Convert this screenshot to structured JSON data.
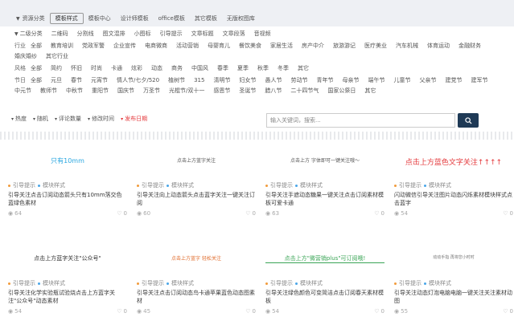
{
  "topbar": {
    "items": [
      "资源分类",
      "模板样式",
      "模板中心",
      "设计师模板",
      "office模板",
      "其它模板",
      "无版权图库"
    ]
  },
  "filters": {
    "category": {
      "label": "",
      "items": [
        "二级分类",
        "二维码",
        "分割线",
        "图文混排",
        "小图标",
        "引导提示",
        "文章标题",
        "文章段落",
        "音视频"
      ]
    },
    "industry": {
      "label": "行业",
      "items": [
        "全部",
        "教育培训",
        "党政军警",
        "企业宣传",
        "电商微商",
        "活动营销",
        "母婴育儿",
        "餐饮美食",
        "家居生活",
        "房产中介",
        "旅游游记",
        "医疗美业",
        "汽车机械",
        "体育运动",
        "金融财务",
        "婚庆婚纱",
        "其它行业"
      ]
    },
    "style": {
      "label": "风格",
      "items": [
        "全部",
        "简约",
        "怀旧",
        "时尚",
        "卡通",
        "炫彩",
        "动态",
        "商务",
        "中国风",
        "春季",
        "夏季",
        "秋季",
        "冬季",
        "其它"
      ]
    },
    "festival": {
      "label": "节日",
      "items": [
        "全部",
        "元旦",
        "春节",
        "元宵节",
        "情人节/七夕/520",
        "植树节",
        "315",
        "清明节",
        "妇女节",
        "愚人节",
        "劳动节",
        "青年节",
        "母亲节",
        "端午节",
        "儿童节",
        "父亲节",
        "建党节",
        "建军节",
        "中元节",
        "教师节",
        "中秋节",
        "重阳节",
        "国庆节",
        "万圣节",
        "光棍节/双十一",
        "感恩节",
        "圣诞节",
        "腊八节",
        "二十四节气",
        "国家公祭日",
        "其它"
      ]
    }
  },
  "sort": {
    "items": [
      "热度",
      "随机",
      "评论数量",
      "修改时间",
      "发布日期"
    ]
  },
  "search": {
    "placeholder": "输入关键词，搜索..."
  },
  "cards": [
    {
      "thumb_text": "只有10mm",
      "tag1": "引导提示",
      "tag2": "模块样式",
      "title": "引导关注点击订阅动态箭头只有10mm落交色蓝绿色素材",
      "views": "64",
      "likes": "0"
    },
    {
      "thumb_text": "点击上方蓝字关注",
      "tag1": "引导提示",
      "tag2": "模块样式",
      "title": "引导关注向上动态箭头点击蓝字关注一键关注订阅",
      "views": "60",
      "likes": "0"
    },
    {
      "thumb_text": "点击上方 字体即可一键关注哦～",
      "tag1": "引导提示",
      "tag2": "模块样式",
      "title": "引导关注手遮动态糖果一键关注点击订阅素材模板可爱卡通",
      "views": "63",
      "likes": "0"
    },
    {
      "thumb_text": "点击上方蓝色文字关注↑↑↑↑",
      "tag1": "引导提示",
      "tag2": "模块样式",
      "title": "闪动微信引导关注图片动态闪烁素材模块样式点击蓝字",
      "views": "54",
      "likes": "0"
    },
    {
      "thumb_text": "点击上方蓝字关注\"公众号\"",
      "tag1": "引导提示",
      "tag2": "模块样式",
      "title": "引导关注化学实验瓶试验烧点击上方蓝字关注\"公众号\"动态素材",
      "views": "54",
      "likes": "0"
    },
    {
      "thumb_text": "点击上方蓝字 轻松关注",
      "tag1": "引导提示",
      "tag2": "模块样式",
      "title": "引导关注点击订阅动态鸟卡通苹果蓝色动态图素材",
      "views": "45",
      "likes": "0"
    },
    {
      "thumb_text": "点击上方\"微营销plus\"可订阅哦!",
      "tag1": "引导提示",
      "tag2": "模块样式",
      "title": "引导关注绿色颜色可变简洁点击订阅春天素材模板",
      "views": "54",
      "likes": "0"
    },
    {
      "thumb_text": "动动手指 再将您小时时",
      "tag1": "引导提示",
      "tag2": "模块样式",
      "title": "引导关注动态灯泡电脑电脑一键关注关注素材动图",
      "views": "55",
      "likes": "0"
    }
  ],
  "colors": {
    "accent": "#e4393c",
    "dark": "#1f3a56",
    "orange": "#f29b3c",
    "blue": "#4aa6e8"
  }
}
